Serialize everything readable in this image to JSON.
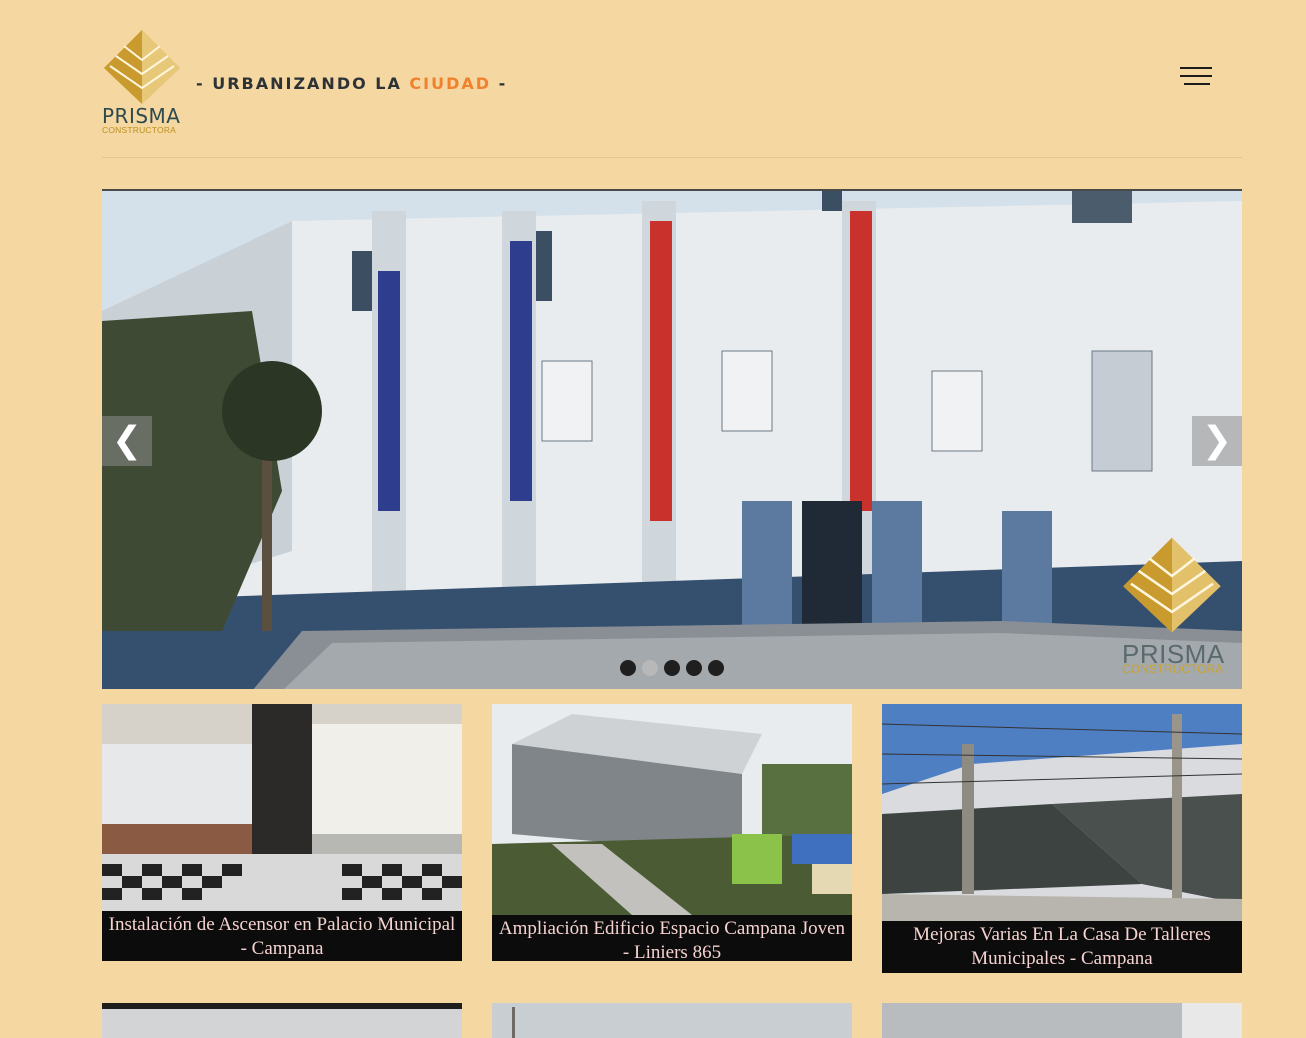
{
  "header": {
    "logo_word": "PRISMA",
    "logo_sub": "CONSTRUCTORA",
    "tagline_prefix": "- URBANIZANDO LA ",
    "tagline_accent": "CIUDAD",
    "tagline_suffix": " -",
    "menu_icon": "hamburger-icon"
  },
  "slider": {
    "prev_label": "❮",
    "next_label": "❯",
    "slide_count": 5,
    "active_slide": 2,
    "watermark_word": "PRISMA",
    "watermark_sub": "CONSTRUCTORA"
  },
  "projects": [
    {
      "caption": "Instalación de Ascensor en Palacio Municipal - Campana"
    },
    {
      "caption": "Ampliación Edificio Espacio Campana Joven - Liniers 865"
    },
    {
      "caption": "Mejoras Varias En La Casa De Talleres Municipales - Campana"
    }
  ],
  "colors": {
    "background": "#f5d7a2",
    "accent": "#f0822e",
    "gold": "#c9a231",
    "caption_bg": "#0c0c0c"
  }
}
